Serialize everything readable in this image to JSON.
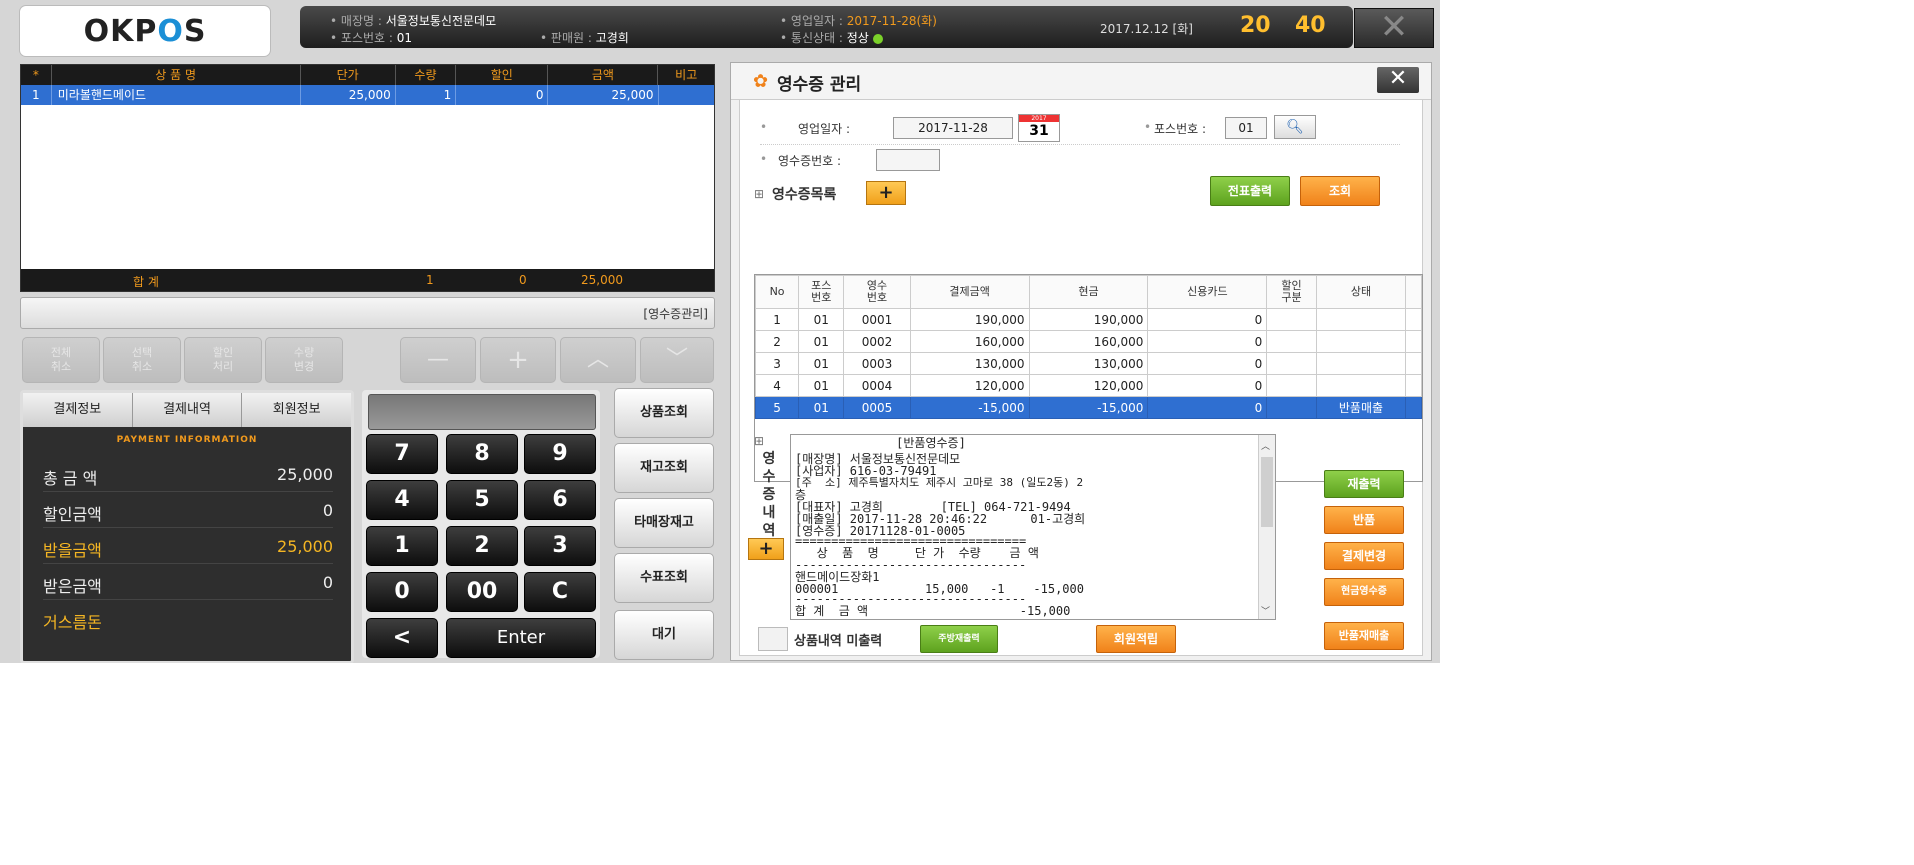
{
  "app": {
    "logo_prefix": "OKP",
    "logo_mid": "O",
    "logo_suffix": "S"
  },
  "topbar": {
    "store_label": "매장명",
    "store_value": "서울정보통신전문데모",
    "pos_label": "포스번호",
    "pos_value": "01",
    "seller_label": "판매원",
    "seller_value": "고경희",
    "bizdate_label": "영업일자",
    "bizdate_value": "2017-11-28(화)",
    "comm_label": "통신상태",
    "comm_value": "정상",
    "date": "2017.12.12 [화]",
    "hour": "20",
    "minute": "40",
    "close_symbol": "✕"
  },
  "items": {
    "headers": [
      "*",
      "상 품 명",
      "단가",
      "수량",
      "할인",
      "금액",
      "비고"
    ],
    "rows": [
      {
        "no": "1",
        "name": "미라볼핸드메이드",
        "price": "25,000",
        "qty": "1",
        "discount": "0",
        "amount": "25,000",
        "note": ""
      }
    ],
    "total_label": "합   계",
    "total_qty": "1",
    "total_discount": "0",
    "total_amount": "25,000"
  },
  "status": {
    "text": "[영수증관리]"
  },
  "func_buttons": [
    "전체\n취소",
    "선택\n취소",
    "할인\n처리",
    "수량\n변경",
    "—",
    "+",
    "︿",
    "﹀"
  ],
  "payment": {
    "tabs": [
      "결제정보",
      "결제내역",
      "회원정보"
    ],
    "title": "PAYMENT INFORMATION",
    "rows": [
      {
        "label": "총 금 액",
        "value": "25,000"
      },
      {
        "label": "할인금액",
        "value": "0"
      },
      {
        "label": "받을금액",
        "value": "25,000"
      },
      {
        "label": "받은금액",
        "value": "0"
      },
      {
        "label": "거스름돈",
        "value": ""
      }
    ]
  },
  "keypad": {
    "keys": [
      "7",
      "8",
      "9",
      "4",
      "5",
      "6",
      "1",
      "2",
      "3",
      "0",
      "00",
      "C",
      "<",
      "Enter"
    ]
  },
  "side_buttons": [
    "상품조회",
    "재고조회",
    "타매장재고",
    "수표조회",
    "대기"
  ],
  "receipt_mgmt": {
    "title": "영수증 관리",
    "bizdate_label": "영업일자 :",
    "bizdate_value": "2017-11-28",
    "cal_day": "31",
    "cal_top": "2017",
    "pos_label": "포스번호 :",
    "pos_value": "01",
    "receipt_no_label": "영수증번호 :",
    "receipt_no_value": "",
    "list_label": "영수증목록",
    "btn_print_slip": "전표출력",
    "btn_search": "조회",
    "grid_headers": [
      "No",
      "포스\n번호",
      "영수\n번호",
      "결제금액",
      "현금",
      "신용카드",
      "할인\n구분",
      "상태"
    ],
    "grid_rows": [
      {
        "no": "1",
        "pos": "01",
        "rno": "0001",
        "pay": "190,000",
        "cash": "190,000",
        "card": "0",
        "disc": "",
        "state": ""
      },
      {
        "no": "2",
        "pos": "01",
        "rno": "0002",
        "pay": "160,000",
        "cash": "160,000",
        "card": "0",
        "disc": "",
        "state": ""
      },
      {
        "no": "3",
        "pos": "01",
        "rno": "0003",
        "pay": "130,000",
        "cash": "130,000",
        "card": "0",
        "disc": "",
        "state": ""
      },
      {
        "no": "4",
        "pos": "01",
        "rno": "0004",
        "pay": "120,000",
        "cash": "120,000",
        "card": "0",
        "disc": "",
        "state": ""
      },
      {
        "no": "5",
        "pos": "01",
        "rno": "0005",
        "pay": "-15,000",
        "cash": "-15,000",
        "card": "0",
        "disc": "",
        "state": "반품매출"
      }
    ],
    "detail_vlabel": "영수증내역",
    "receipt_lines": [
      "              [반품영수증]",
      "[매장명] 서울정보통신전문데모",
      "[사업자] 616-03-79491",
      "[주  소] 제주특별자치도 제주시 고마로 38 (일도2동) 2",
      "층",
      "[대표자] 고경희        [TEL] 064-721-9494",
      "[매출일] 2017-11-28 20:46:22      01-고경희",
      "[영수증] 20171128-01-0005",
      "================================",
      "   상  품  명     단 가  수량    금 액",
      "--------------------------------",
      "핸드메이드장화1",
      "000001            15,000   -1    -15,000",
      "--------------------------------",
      "합 계  금 액                     -15,000"
    ],
    "no_print_label": "상품내역 미출력",
    "btn_reprint_sub": "주방재출력",
    "btn_member": "회원적립",
    "right_buttons": [
      "재출력",
      "반품",
      "결제변경",
      "현금영수증",
      "반품재매출"
    ]
  }
}
